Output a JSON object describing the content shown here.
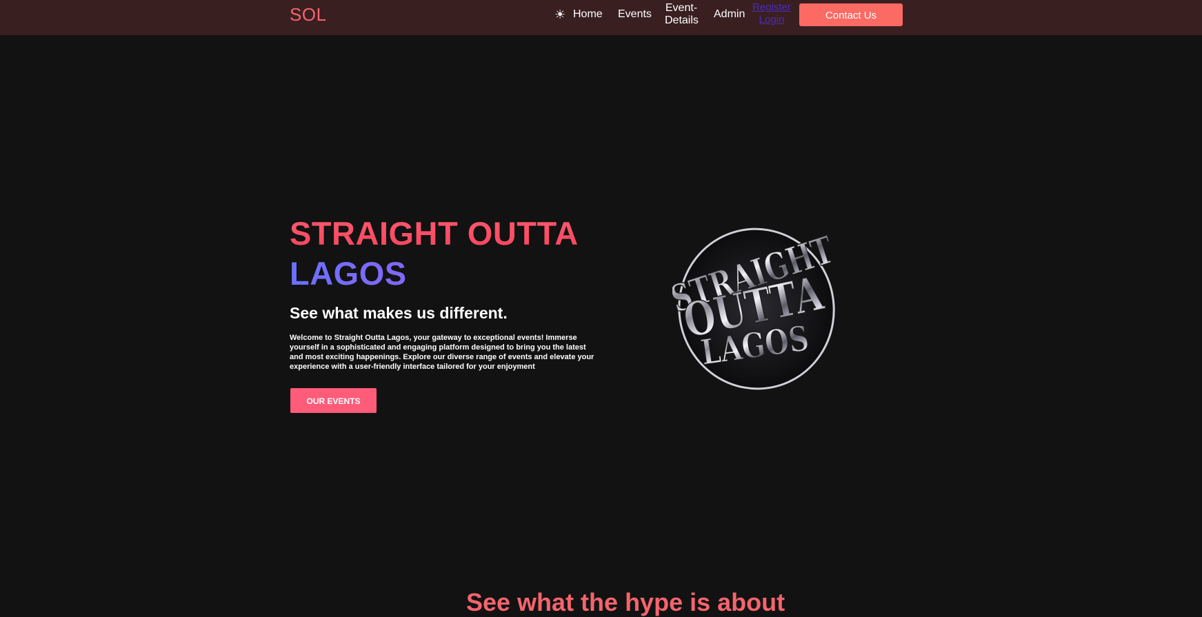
{
  "nav": {
    "brand": "SOL",
    "theme_icon": "sun-icon",
    "links": [
      "Home",
      "Events",
      "Event-\nDetails",
      "Admin"
    ],
    "register": "Register",
    "login": "Login",
    "contact": "Contact Us"
  },
  "hero": {
    "title_line1": "STRAIGHT OUTTA",
    "title_line2": "LAGOS",
    "subtitle": "See what makes us different.",
    "description": "Welcome to Straight Outta Lagos, your gateway to exceptional events! Immerse yourself in a sophisticated and engaging platform designed to bring you the latest and most exciting happenings. Explore our diverse range of events and elevate your experience with a user-friendly interface tailored for your enjoyment",
    "button": "OUR EVENTS",
    "logo_text": [
      "STRAIGHT",
      "OUTTA",
      "LAGOS"
    ]
  },
  "next_section": {
    "heading_partial": "See what the hype is about"
  },
  "colors": {
    "nav_bg": "#3a1f21",
    "page_bg": "#121212",
    "accent": "#fb6a63",
    "brand": "#f4646d",
    "button": "#ff5c7a"
  }
}
